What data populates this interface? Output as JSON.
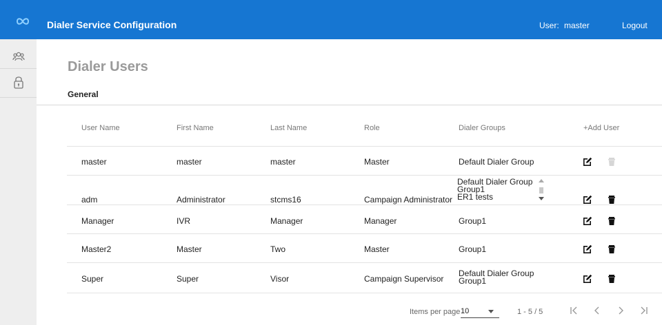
{
  "header": {
    "title": "Dialer Service Configuration",
    "user_label": "User:",
    "user_name": "master",
    "logout_label": "Logout"
  },
  "sidebar": {
    "items": [
      {
        "icon": "users-icon"
      },
      {
        "icon": "lock-icon"
      }
    ]
  },
  "page": {
    "title": "Dialer Users",
    "tab": "General"
  },
  "table": {
    "headers": [
      "User Name",
      "First Name",
      "Last Name",
      "Role",
      "Dialer Groups"
    ],
    "add_user_label": "+Add User",
    "rows": [
      {
        "user_name": "master",
        "first_name": "master",
        "last_name": "master",
        "role": "Master",
        "groups": [
          "Default Dialer Group"
        ],
        "delete_enabled": false
      },
      {
        "user_name": "adm",
        "first_name": "Administrator",
        "last_name": "stcms16",
        "role": "Campaign Administrator",
        "groups": [
          "Default Dialer Group",
          "Group1",
          "ER1 tests"
        ],
        "delete_enabled": true
      },
      {
        "user_name": "Manager",
        "first_name": "IVR",
        "last_name": "Manager",
        "role": "Manager",
        "groups": [
          "Group1"
        ],
        "delete_enabled": true
      },
      {
        "user_name": "Master2",
        "first_name": "Master",
        "last_name": "Two",
        "role": "Master",
        "groups": [
          "Group1"
        ],
        "delete_enabled": true
      },
      {
        "user_name": "Super",
        "first_name": "Super",
        "last_name": "Visor",
        "role": "Campaign Supervisor",
        "groups": [
          "Default Dialer Group",
          "Group1"
        ],
        "delete_enabled": true
      }
    ]
  },
  "paginator": {
    "items_per_page_label": "Items per page",
    "items_per_page_value": "10",
    "range_label": "1 - 5 / 5"
  },
  "colors": {
    "header_bg": "#1676d2",
    "sidebar_bg": "#eeeeee",
    "title_gray": "#9a9a9a"
  }
}
